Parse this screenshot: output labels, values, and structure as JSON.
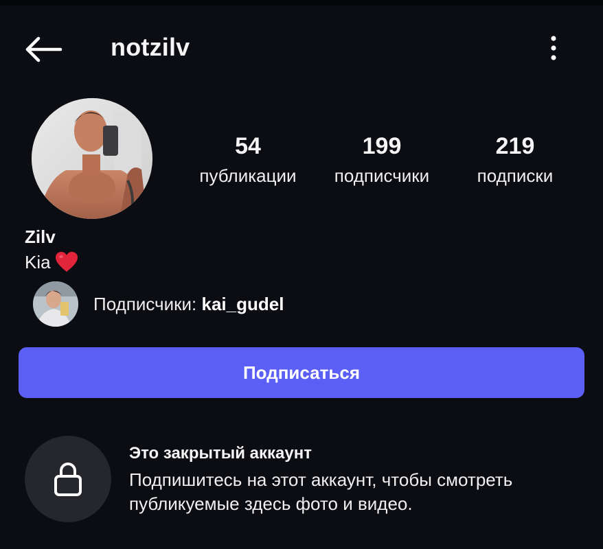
{
  "header": {
    "username": "notzilv",
    "back_icon": "arrow-left-icon",
    "more_icon": "more-vertical-icon"
  },
  "profile": {
    "avatar_icon": "profile-photo",
    "display_name": "Zilv",
    "bio_text": "Kia",
    "bio_emoji": "heart-icon",
    "heart_color": "#e3253b"
  },
  "stats": {
    "posts": {
      "value": "54",
      "label": "публикации"
    },
    "followers": {
      "value": "199",
      "label": "подписчики"
    },
    "following": {
      "value": "219",
      "label": "подписки"
    }
  },
  "followed_by": {
    "prefix": "Подписчики: ",
    "username": "kai_gudel"
  },
  "actions": {
    "follow_label": "Подписаться",
    "follow_color": "#5b5ff6"
  },
  "private_notice": {
    "title": "Это закрытый аккаунт",
    "description": "Подпишитесь на этот аккаунт, чтобы смотреть публикуемые здесь фото и видео.",
    "icon": "lock-icon"
  },
  "colors": {
    "background": "#0c0d12",
    "accent": "#5b5ff6"
  }
}
